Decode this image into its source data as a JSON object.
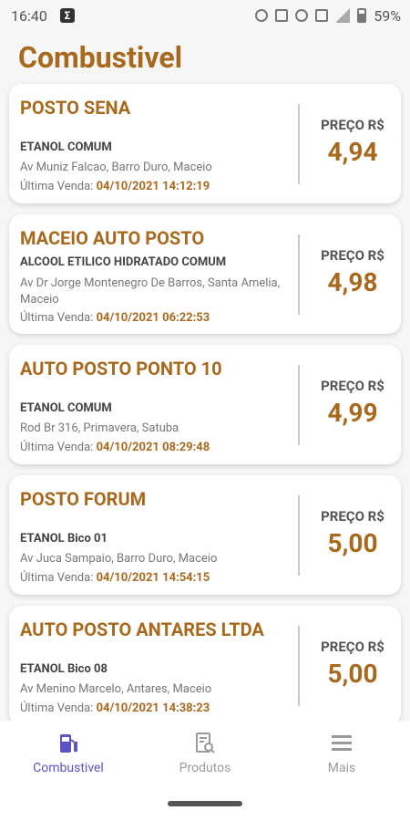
{
  "status": {
    "time": "16:40",
    "battery": "59%"
  },
  "title": "Combustivel",
  "stations": [
    {
      "name": "POSTO SENA",
      "fuel": "ETANOL COMUM",
      "address": "Av Muniz Falcao, Barro Duro, Maceio",
      "sale_label": "Última Venda:",
      "sale_date": "04/10/2021 14:12:19",
      "price_label": "PREÇO R$",
      "price": "4,94"
    },
    {
      "name": "MACEIO AUTO POSTO",
      "fuel": "ALCOOL ETILICO HIDRATADO COMUM",
      "address": "Av Dr Jorge Montenegro De Barros, Santa Amelia, Maceio",
      "sale_label": "Última Venda:",
      "sale_date": "04/10/2021 06:22:53",
      "price_label": "PREÇO R$",
      "price": "4,98"
    },
    {
      "name": "AUTO POSTO PONTO 10",
      "fuel": "ETANOL COMUM",
      "address": "Rod Br 316, Primavera, Satuba",
      "sale_label": "Última Venda:",
      "sale_date": "04/10/2021 08:29:48",
      "price_label": "PREÇO R$",
      "price": "4,99"
    },
    {
      "name": "POSTO FORUM",
      "fuel": "ETANOL Bico 01",
      "address": "Av Juca Sampaio, Barro Duro, Maceio",
      "sale_label": "Última Venda:",
      "sale_date": "04/10/2021 14:54:15",
      "price_label": "PREÇO R$",
      "price": "5,00"
    },
    {
      "name": "AUTO POSTO ANTARES LTDA",
      "fuel": "ETANOL Bico 08",
      "address": "Av Menino Marcelo, Antares, Maceio",
      "sale_label": "Última Venda:",
      "sale_date": "04/10/2021 14:38:23",
      "price_label": "PREÇO R$",
      "price": "5,00"
    }
  ],
  "nav": [
    {
      "label": "Combustivel",
      "icon": "fuel-pump-icon",
      "active": true
    },
    {
      "label": "Produtos",
      "icon": "receipt-search-icon",
      "active": false
    },
    {
      "label": "Mais",
      "icon": "menu-icon",
      "active": false
    }
  ],
  "colors": {
    "accent": "#a9691c",
    "nav_active": "#5c54c4"
  }
}
